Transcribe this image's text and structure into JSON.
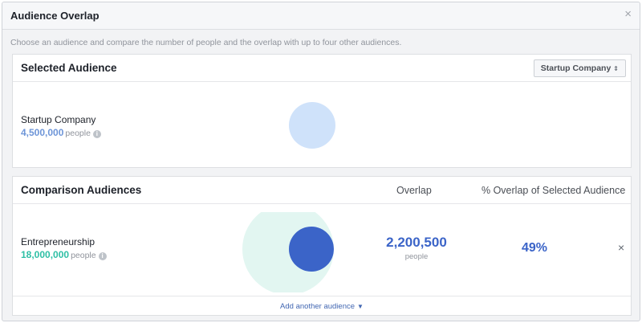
{
  "dialog": {
    "title": "Audience Overlap",
    "close_glyph": "×",
    "subtitle": "Choose an audience and compare the number of people and the overlap with up to four other audiences."
  },
  "selected": {
    "title": "Selected Audience",
    "dropdown_value": "Startup Company",
    "dropdown_glyph": "⇕",
    "audience": {
      "name": "Startup Company",
      "count": "4,500,000",
      "unit": "people",
      "info_icon": "info-icon"
    }
  },
  "comparison": {
    "title": "Comparison Audiences",
    "col_overlap": "Overlap",
    "col_pct": "% Overlap of Selected Audience",
    "rows": [
      {
        "name": "Entrepreneurship",
        "count": "18,000,000",
        "unit": "people",
        "overlap": "2,200,500",
        "overlap_unit": "people",
        "pct": "49%",
        "remove_glyph": "×"
      }
    ],
    "add_link": "Add another audience",
    "add_caret": "▼"
  },
  "colors": {
    "selected_circle": "#cfe2fa",
    "comparison_circle": "#e2f6f1",
    "intersection": "#3b64c8",
    "accent_blue": "#3b64c8",
    "accent_teal": "#2ebfa5",
    "selected_count": "#6d95d8"
  }
}
